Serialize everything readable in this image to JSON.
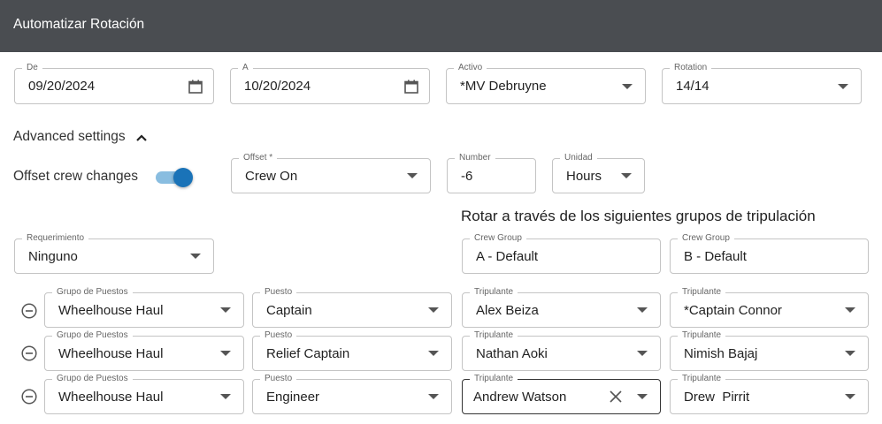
{
  "window": {
    "title": "Automatizar Rotación"
  },
  "date_range": {
    "from": {
      "label": "De",
      "value": "09/20/2024"
    },
    "to": {
      "label": "A",
      "value": "10/20/2024"
    }
  },
  "asset": {
    "label": "Activo",
    "value": "*MV Debruyne"
  },
  "rotation": {
    "label": "Rotation",
    "value": "14/14"
  },
  "advanced": {
    "title": "Advanced settings",
    "offset_toggle_label": "Offset crew changes",
    "offset_toggle_on": true,
    "offset": {
      "label": "Offset *",
      "value": "Crew On"
    },
    "number": {
      "label": "Number",
      "value": "-6"
    },
    "unit": {
      "label": "Unidad",
      "value": "Hours"
    }
  },
  "requirement": {
    "label": "Requerimiento",
    "value": "Ninguno"
  },
  "crew_groups_heading": "Rotar a través de los siguientes grupos de tripulación",
  "crew_groups": [
    {
      "label": "Crew Group",
      "value": "A - Default"
    },
    {
      "label": "Crew Group",
      "value": "B - Default"
    }
  ],
  "rows": [
    {
      "group": {
        "label": "Grupo de Puestos",
        "value": "Wheelhouse Haul"
      },
      "position": {
        "label": "Puesto",
        "value": "Captain"
      },
      "crew_a": {
        "label": "Tripulante",
        "value": "Alex Beiza"
      },
      "crew_b": {
        "label": "Tripulante",
        "value": "*Captain Connor"
      }
    },
    {
      "group": {
        "label": "Grupo de Puestos",
        "value": "Wheelhouse Haul"
      },
      "position": {
        "label": "Puesto",
        "value": "Relief Captain"
      },
      "crew_a": {
        "label": "Tripulante",
        "value": "Nathan Aoki"
      },
      "crew_b": {
        "label": "Tripulante",
        "value": "Nimish Bajaj"
      }
    },
    {
      "group": {
        "label": "Grupo de Puestos",
        "value": "Wheelhouse Haul"
      },
      "position": {
        "label": "Puesto",
        "value": "Engineer"
      },
      "crew_a": {
        "label": "Tripulante",
        "value": "Andrew Watson"
      },
      "crew_b": {
        "label": "Tripulante",
        "value": "Drew  Pirrit"
      }
    }
  ],
  "icons": {
    "calendar": "calendar-icon",
    "dropdown": "chevron-down-icon",
    "collapse": "chevron-up-icon",
    "remove_row": "minus-circle-icon",
    "clear": "close-icon"
  },
  "colors": {
    "titlebar": "#4a4d51",
    "toggle_on": "#1a73b8",
    "toggle_track": "#89bde0"
  }
}
